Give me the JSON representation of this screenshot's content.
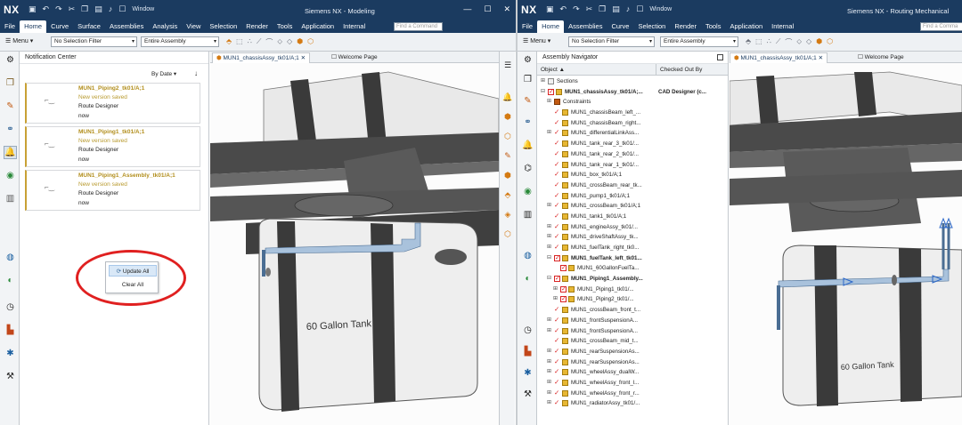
{
  "window_left": {
    "logo": "NX",
    "window_menu": "Window",
    "title": "Siemens NX - Modeling",
    "menu": [
      "File",
      "Home",
      "Curve",
      "Surface",
      "Assemblies",
      "Analysis",
      "View",
      "Selection",
      "Render",
      "Tools",
      "Application",
      "Internal"
    ],
    "active_menu": "Home",
    "find_command_placeholder": "Find a Command",
    "toolbar": {
      "menu_label": "Menu",
      "selection_filter": "No Selection Filter",
      "assembly_scope": "Entire Assembly"
    },
    "notification_center": {
      "title": "Notification Center",
      "sort_label": "By Date",
      "cards": [
        {
          "title": "MUN1_Piping2_tk01/A;1",
          "status": "New version saved",
          "source": "Route Designer",
          "time": "now"
        },
        {
          "title": "MUN1_Piping1_tk01/A;1",
          "status": "New version saved",
          "source": "Route Designer",
          "time": "now"
        },
        {
          "title": "MUN1_Piping1_Assembly_tk01/A;1",
          "status": "New version saved",
          "source": "Route Designer",
          "time": "now"
        }
      ]
    },
    "context_menu": {
      "update_all": "Update All",
      "clear_all": "Clear All"
    },
    "tabs": [
      "MUN1_chassisAssy_tk01/A;1",
      "Welcome Page"
    ],
    "tank_label": "60 Gallon Tank"
  },
  "window_right": {
    "logo": "NX",
    "window_menu": "Window",
    "title": "Siemens NX - Routing Mechanical",
    "menu": [
      "File",
      "Home",
      "Assemblies",
      "Curve",
      "Selection",
      "Render",
      "Tools",
      "Application",
      "Internal"
    ],
    "active_menu": "Home",
    "find_command_placeholder": "Find a Comma",
    "toolbar": {
      "menu_label": "Menu",
      "selection_filter": "No Selection Filter",
      "assembly_scope": "Entire Assembly"
    },
    "assembly_navigator": {
      "title": "Assembly Navigator",
      "col_object": "Object",
      "col_checked_out": "Checked Out By",
      "rows": [
        {
          "label": "Sections",
          "level": 0,
          "exp": "+",
          "check": false,
          "tick": false,
          "bold": false,
          "checked_out": ""
        },
        {
          "label": "MUN1_chassisAssy_tk01/A;...",
          "level": 0,
          "exp": "-",
          "check": true,
          "tick": false,
          "bold": true,
          "checked_out": "CAD Designer (c..."
        },
        {
          "label": "Constraints",
          "level": 1,
          "exp": "+",
          "check": false,
          "tick": false,
          "bold": false,
          "checked_out": ""
        },
        {
          "label": "MUN1_chassisBeam_left_...",
          "level": 1,
          "exp": "",
          "check": false,
          "tick": true,
          "bold": false,
          "checked_out": ""
        },
        {
          "label": "MUN1_chassisBeam_right...",
          "level": 1,
          "exp": "",
          "check": false,
          "tick": true,
          "bold": false,
          "checked_out": ""
        },
        {
          "label": "MUN1_differentialLinkAss...",
          "level": 1,
          "exp": "+",
          "check": false,
          "tick": true,
          "bold": false,
          "checked_out": ""
        },
        {
          "label": "MUN1_tank_rear_3_tk01/...",
          "level": 1,
          "exp": "",
          "check": false,
          "tick": true,
          "bold": false,
          "checked_out": ""
        },
        {
          "label": "MUN1_tank_rear_2_tk01/...",
          "level": 1,
          "exp": "",
          "check": false,
          "tick": true,
          "bold": false,
          "checked_out": ""
        },
        {
          "label": "MUN1_tank_rear_1_tk01/...",
          "level": 1,
          "exp": "",
          "check": false,
          "tick": true,
          "bold": false,
          "checked_out": ""
        },
        {
          "label": "MUN1_box_tk01/A;1",
          "level": 1,
          "exp": "",
          "check": false,
          "tick": true,
          "bold": false,
          "checked_out": ""
        },
        {
          "label": "MUN1_crossBeam_rear_tk...",
          "level": 1,
          "exp": "",
          "check": false,
          "tick": true,
          "bold": false,
          "checked_out": ""
        },
        {
          "label": "MUN1_pump1_tk01/A;1",
          "level": 1,
          "exp": "",
          "check": false,
          "tick": true,
          "bold": false,
          "checked_out": ""
        },
        {
          "label": "MUN1_crossBeam_tk01/A;1",
          "level": 1,
          "exp": "+",
          "check": false,
          "tick": true,
          "bold": false,
          "checked_out": ""
        },
        {
          "label": "MUN1_tank1_tk01/A;1",
          "level": 1,
          "exp": "",
          "check": false,
          "tick": true,
          "bold": false,
          "checked_out": ""
        },
        {
          "label": "MUN1_engineAssy_tk01/...",
          "level": 1,
          "exp": "+",
          "check": false,
          "tick": true,
          "bold": false,
          "checked_out": ""
        },
        {
          "label": "MUN1_driveShaftAssy_tk...",
          "level": 1,
          "exp": "+",
          "check": false,
          "tick": true,
          "bold": false,
          "checked_out": ""
        },
        {
          "label": "MUN1_fuelTank_right_tk0...",
          "level": 1,
          "exp": "+",
          "check": false,
          "tick": true,
          "bold": false,
          "checked_out": ""
        },
        {
          "label": "MUN1_fuelTank_left_tk01...",
          "level": 1,
          "exp": "-",
          "check": true,
          "tick": false,
          "bold": true,
          "checked_out": ""
        },
        {
          "label": "MUN1_60GallonFuelTa...",
          "level": 2,
          "exp": "",
          "check": true,
          "tick": false,
          "bold": false,
          "checked_out": ""
        },
        {
          "label": "MUN1_Piping1_Assembly...",
          "level": 1,
          "exp": "-",
          "check": true,
          "tick": false,
          "bold": true,
          "checked_out": ""
        },
        {
          "label": "MUN1_Piping1_tk01/...",
          "level": 2,
          "exp": "+",
          "check": true,
          "tick": false,
          "bold": false,
          "checked_out": ""
        },
        {
          "label": "MUN1_Piping2_tk01/...",
          "level": 2,
          "exp": "+",
          "check": true,
          "tick": false,
          "bold": false,
          "checked_out": ""
        },
        {
          "label": "MUN1_crossBeam_front_t...",
          "level": 1,
          "exp": "",
          "check": false,
          "tick": true,
          "bold": false,
          "checked_out": ""
        },
        {
          "label": "MUN1_frontSuspensionA...",
          "level": 1,
          "exp": "+",
          "check": false,
          "tick": true,
          "bold": false,
          "checked_out": ""
        },
        {
          "label": "MUN1_frontSuspensionA...",
          "level": 1,
          "exp": "+",
          "check": false,
          "tick": true,
          "bold": false,
          "checked_out": ""
        },
        {
          "label": "MUN1_crossBeam_mid_t...",
          "level": 1,
          "exp": "",
          "check": false,
          "tick": true,
          "bold": false,
          "checked_out": ""
        },
        {
          "label": "MUN1_rearSuspensionAs...",
          "level": 1,
          "exp": "+",
          "check": false,
          "tick": true,
          "bold": false,
          "checked_out": ""
        },
        {
          "label": "MUN1_rearSuspensionAs...",
          "level": 1,
          "exp": "+",
          "check": false,
          "tick": true,
          "bold": false,
          "checked_out": ""
        },
        {
          "label": "MUN1_wheelAssy_dualW...",
          "level": 1,
          "exp": "+",
          "check": false,
          "tick": true,
          "bold": false,
          "checked_out": ""
        },
        {
          "label": "MUN1_wheelAssy_front_l...",
          "level": 1,
          "exp": "+",
          "check": false,
          "tick": true,
          "bold": false,
          "checked_out": ""
        },
        {
          "label": "MUN1_wheelAssy_front_r...",
          "level": 1,
          "exp": "+",
          "check": false,
          "tick": true,
          "bold": false,
          "checked_out": ""
        },
        {
          "label": "MUN1_radiatorAssy_tk01/...",
          "level": 1,
          "exp": "+",
          "check": false,
          "tick": true,
          "bold": false,
          "checked_out": ""
        }
      ]
    },
    "tabs": [
      "MUN1_chassisAssy_tk01/A;1",
      "Welcome Page"
    ],
    "tank_label": "60 Gallon Tank"
  },
  "colors": {
    "titlebar": "#1b3b60",
    "card_accent": "#c8a135",
    "highlight_ring": "#e02020"
  }
}
